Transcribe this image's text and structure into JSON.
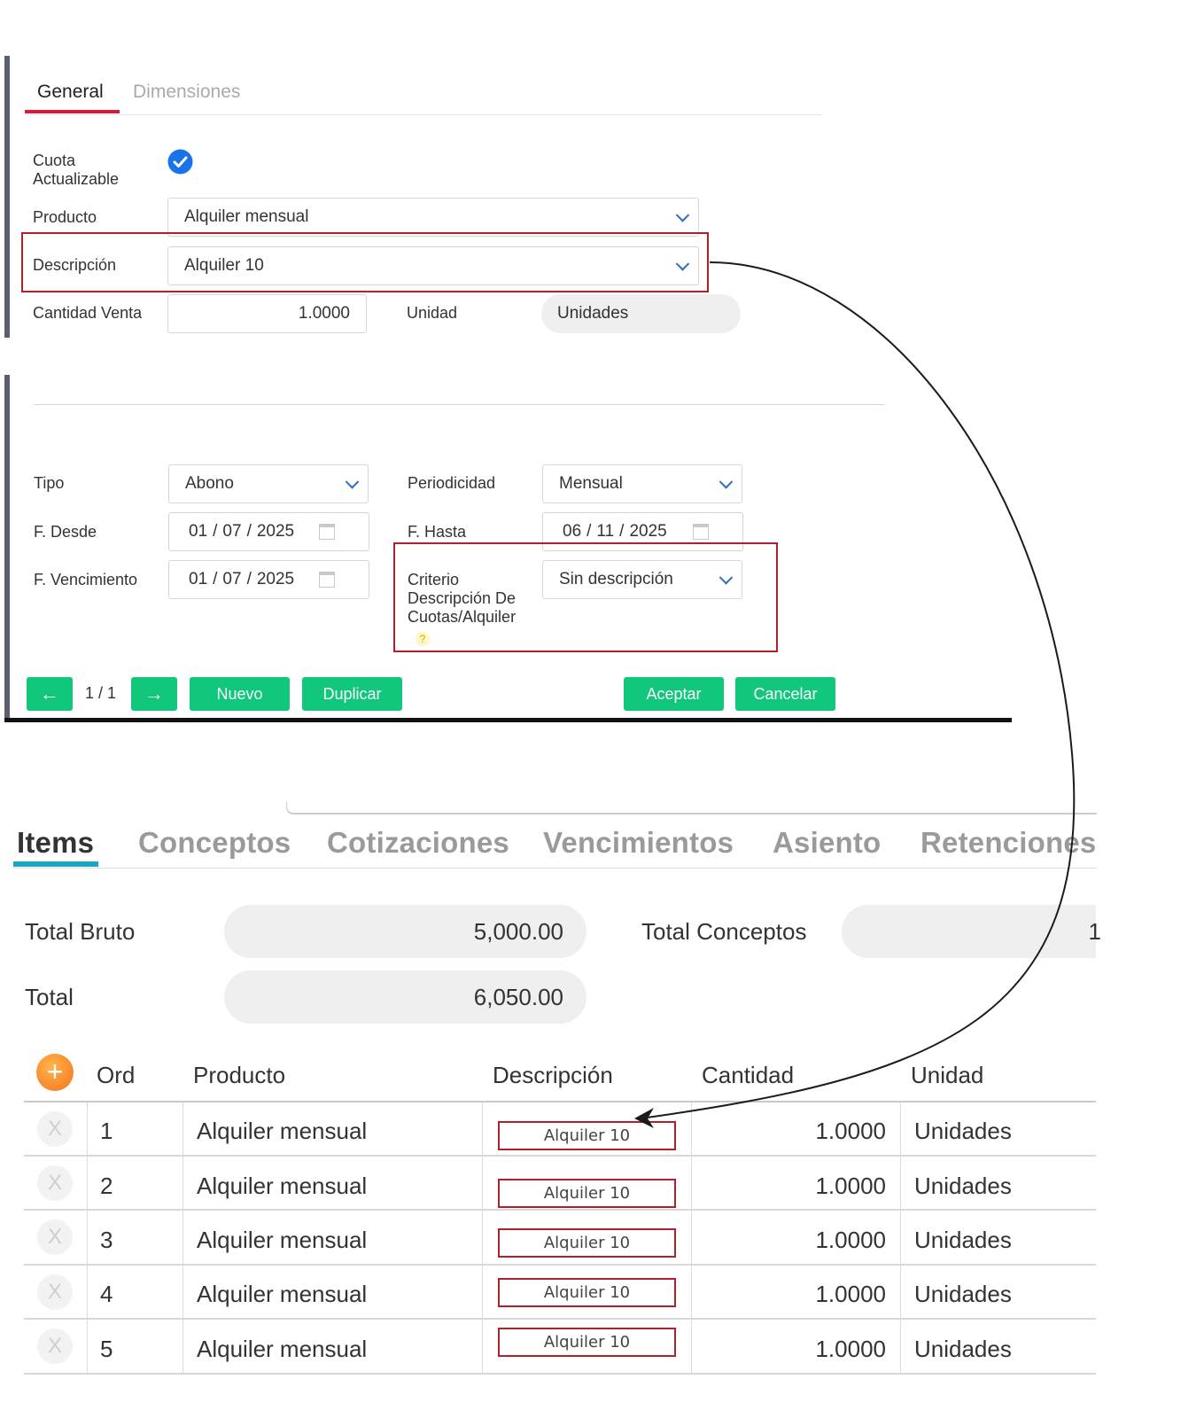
{
  "top_tabs": [
    "General",
    "Dimensiones"
  ],
  "form": {
    "cuota_label": "Cuota Actualizable",
    "producto_label": "Producto",
    "producto_value": "Alquiler mensual",
    "descripcion_label": "Descripción",
    "descripcion_value": "Alquiler 10",
    "cantidad_label": "Cantidad Venta",
    "cantidad_value": "1.0000",
    "unidad_label": "Unidad",
    "unidad_value": "Unidades",
    "tipo_label": "Tipo",
    "tipo_value": "Abono",
    "periodicidad_label": "Periodicidad",
    "periodicidad_value": "Mensual",
    "fdesde_label": "F. Desde",
    "fdesde": {
      "d": "01",
      "m": "07",
      "y": "2025"
    },
    "fhasta_label": "F. Hasta",
    "fhasta": {
      "d": "06",
      "m": "11",
      "y": "2025"
    },
    "fvenc_label": "F. Vencimiento",
    "fvenc": {
      "d": "01",
      "m": "07",
      "y": "2025"
    },
    "criterio_label_1": "Criterio",
    "criterio_label_2": "Descripción De",
    "criterio_label_3": "Cuotas/Alquiler",
    "criterio_help": "?",
    "criterio_value": "Sin descripción"
  },
  "nav": {
    "prev": "←",
    "page": "1 / 1",
    "next": "→",
    "nuevo": "Nuevo",
    "duplicar": "Duplicar",
    "aceptar": "Aceptar",
    "cancelar": "Cancelar"
  },
  "bottom_tabs": [
    "Items",
    "Conceptos",
    "Cotizaciones",
    "Vencimientos",
    "Asiento",
    "Retenciones"
  ],
  "totals": {
    "bruto_label": "Total Bruto",
    "bruto_value": "5,000.00",
    "conceptos_label": "Total Conceptos",
    "conceptos_value": "1",
    "total_label": "Total",
    "total_value": "6,050.00"
  },
  "table": {
    "add_icon": "+",
    "headers": [
      "Ord",
      "Producto",
      "Descripción",
      "Cantidad",
      "Unidad"
    ],
    "remove_icon": "X",
    "rows": [
      {
        "ord": "1",
        "producto": "Alquiler mensual",
        "descripcion": "Alquiler 10",
        "cantidad": "1.0000",
        "unidad": "Unidades"
      },
      {
        "ord": "2",
        "producto": "Alquiler mensual",
        "descripcion": "Alquiler 10",
        "cantidad": "1.0000",
        "unidad": "Unidades"
      },
      {
        "ord": "3",
        "producto": "Alquiler mensual",
        "descripcion": "Alquiler 10",
        "cantidad": "1.0000",
        "unidad": "Unidades"
      },
      {
        "ord": "4",
        "producto": "Alquiler mensual",
        "descripcion": "Alquiler 10",
        "cantidad": "1.0000",
        "unidad": "Unidades"
      },
      {
        "ord": "5",
        "producto": "Alquiler mensual",
        "descripcion": "Alquiler 10",
        "cantidad": "1.0000",
        "unidad": "Unidades"
      }
    ]
  },
  "colors": {
    "accent_green": "#10c77c",
    "highlight_red": "#b0202a",
    "tab_red": "#d01f3c",
    "tab_teal": "#1aa6c4",
    "check_blue": "#1a73e8"
  }
}
